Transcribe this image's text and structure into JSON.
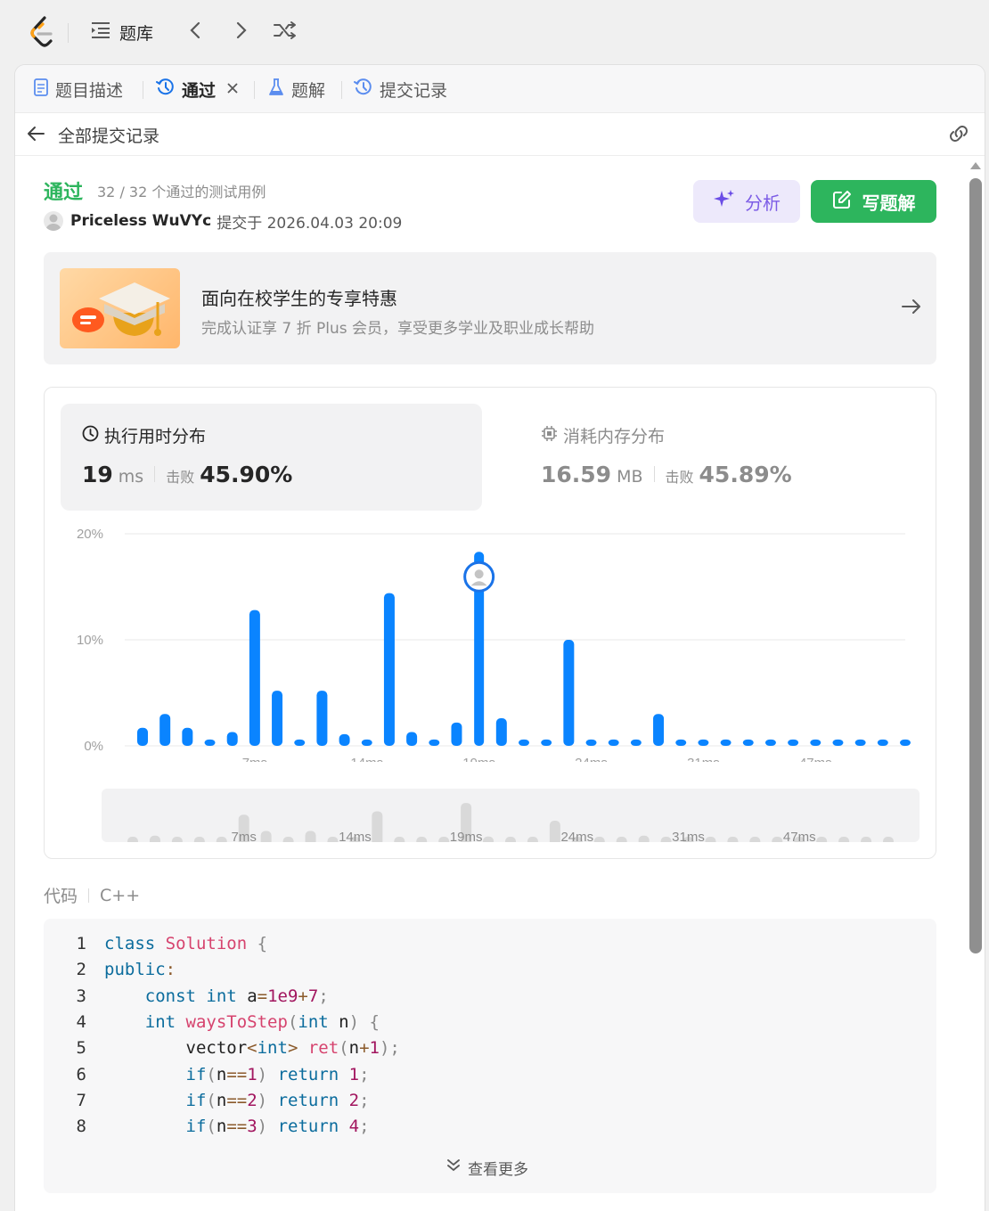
{
  "topbar": {
    "problems_label": "题库"
  },
  "tabs": [
    {
      "label": "题目描述"
    },
    {
      "label": "通过"
    },
    {
      "label": "题解"
    },
    {
      "label": "提交记录"
    }
  ],
  "subheader": {
    "title": "全部提交记录"
  },
  "result": {
    "status": "通过",
    "cases": "32 / 32 个通过的测试用例",
    "user": "Priceless WuVYc",
    "submitted": "提交于 2026.04.03 20:09"
  },
  "buttons": {
    "analyze": "分析",
    "write": "写题解"
  },
  "promo": {
    "title": "面向在校学生的专享特惠",
    "subtitle": "完成认证享 7 折 Plus 会员，享受更多学业及职业成长帮助"
  },
  "runtime": {
    "title": "执行用时分布",
    "value": "19",
    "unit": "ms",
    "beat_label": "击败",
    "beat": "45.90%"
  },
  "memory": {
    "title": "消耗内存分布",
    "value": "16.59",
    "unit": "MB",
    "beat_label": "击败",
    "beat": "45.89%"
  },
  "chart_data": {
    "type": "bar",
    "y_ticks": [
      "20%",
      "10%",
      "0%"
    ],
    "ylim": [
      0,
      20
    ],
    "x_tick_labels": [
      "7ms",
      "14ms",
      "19ms",
      "24ms",
      "31ms",
      "47ms"
    ],
    "x_tick_positions": [
      5,
      10,
      15,
      20,
      25,
      30
    ],
    "values": [
      1.7,
      3.0,
      1.7,
      0.6,
      1.3,
      12.8,
      5.2,
      0.6,
      5.2,
      1.1,
      0.6,
      14.4,
      1.3,
      0.6,
      2.2,
      18.3,
      2.6,
      0.6,
      0.6,
      10.0,
      0.6,
      0.6,
      0.6,
      3.0,
      0.6,
      0.6,
      0.6,
      0.6,
      0.6,
      0.6,
      0.6,
      0.6,
      0.6,
      0.6,
      0.6
    ],
    "highlight_index": 15,
    "color": "#0a84ff"
  },
  "code": {
    "label": "代码",
    "language": "C++",
    "lines": [
      {
        "n": "1",
        "t": [
          [
            "kw",
            "class"
          ],
          [
            "id",
            " "
          ],
          [
            "fn",
            "Solution"
          ],
          [
            "id",
            " "
          ],
          [
            "pn",
            "{"
          ]
        ]
      },
      {
        "n": "2",
        "t": [
          [
            "kw",
            "public"
          ],
          [
            "op",
            ":"
          ]
        ]
      },
      {
        "n": "3",
        "t": [
          [
            "id",
            "    "
          ],
          [
            "kw",
            "const"
          ],
          [
            "id",
            " "
          ],
          [
            "ty",
            "int"
          ],
          [
            "id",
            " a"
          ],
          [
            "op",
            "="
          ],
          [
            "nm",
            "1e9"
          ],
          [
            "op",
            "+"
          ],
          [
            "nm",
            "7"
          ],
          [
            "pn",
            ";"
          ]
        ]
      },
      {
        "n": "4",
        "t": [
          [
            "id",
            "    "
          ],
          [
            "ty",
            "int"
          ],
          [
            "id",
            " "
          ],
          [
            "fn",
            "waysToStep"
          ],
          [
            "pn",
            "("
          ],
          [
            "ty",
            "int"
          ],
          [
            "id",
            " n"
          ],
          [
            "pn",
            ")"
          ],
          [
            "id",
            " "
          ],
          [
            "pn",
            "{"
          ]
        ]
      },
      {
        "n": "5",
        "t": [
          [
            "id",
            "        vector"
          ],
          [
            "op",
            "<"
          ],
          [
            "ty",
            "int"
          ],
          [
            "op",
            ">"
          ],
          [
            "id",
            " "
          ],
          [
            "fn",
            "ret"
          ],
          [
            "pn",
            "("
          ],
          [
            "id",
            "n"
          ],
          [
            "op",
            "+"
          ],
          [
            "nm",
            "1"
          ],
          [
            "pn",
            ");"
          ]
        ]
      },
      {
        "n": "6",
        "t": [
          [
            "id",
            "        "
          ],
          [
            "kw",
            "if"
          ],
          [
            "pn",
            "("
          ],
          [
            "id",
            "n"
          ],
          [
            "op",
            "=="
          ],
          [
            "nm",
            "1"
          ],
          [
            "pn",
            ")"
          ],
          [
            "id",
            " "
          ],
          [
            "kw",
            "return"
          ],
          [
            "id",
            " "
          ],
          [
            "nm",
            "1"
          ],
          [
            "pn",
            ";"
          ]
        ]
      },
      {
        "n": "7",
        "t": [
          [
            "id",
            "        "
          ],
          [
            "kw",
            "if"
          ],
          [
            "pn",
            "("
          ],
          [
            "id",
            "n"
          ],
          [
            "op",
            "=="
          ],
          [
            "nm",
            "2"
          ],
          [
            "pn",
            ")"
          ],
          [
            "id",
            " "
          ],
          [
            "kw",
            "return"
          ],
          [
            "id",
            " "
          ],
          [
            "nm",
            "2"
          ],
          [
            "pn",
            ";"
          ]
        ]
      },
      {
        "n": "8",
        "t": [
          [
            "id",
            "        "
          ],
          [
            "kw",
            "if"
          ],
          [
            "pn",
            "("
          ],
          [
            "id",
            "n"
          ],
          [
            "op",
            "=="
          ],
          [
            "nm",
            "3"
          ],
          [
            "pn",
            ")"
          ],
          [
            "id",
            " "
          ],
          [
            "kw",
            "return"
          ],
          [
            "id",
            " "
          ],
          [
            "nm",
            "4"
          ],
          [
            "pn",
            ";"
          ]
        ]
      }
    ],
    "more_label": "查看更多"
  }
}
